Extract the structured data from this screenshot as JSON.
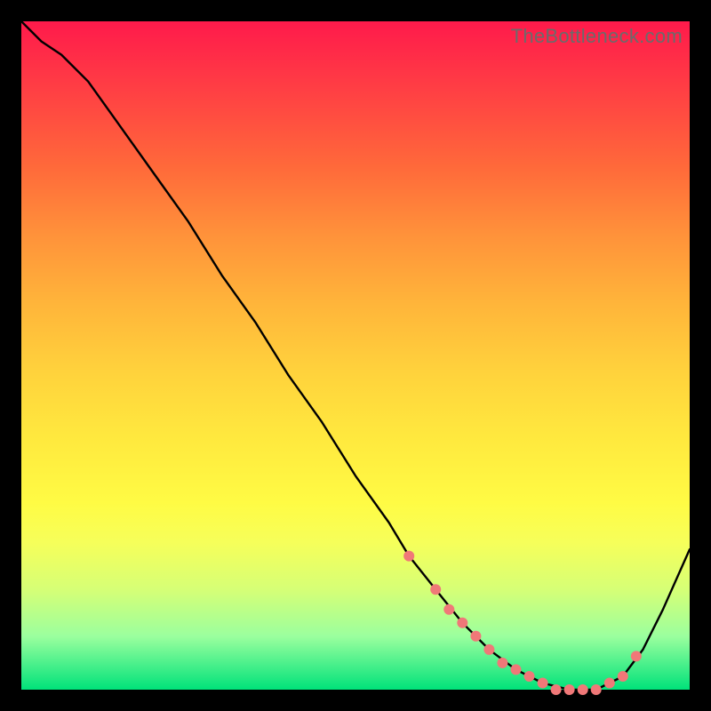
{
  "watermark": "TheBottleneck.com",
  "chart_data": {
    "type": "line",
    "title": "",
    "xlabel": "",
    "ylabel": "",
    "xlim": [
      0,
      100
    ],
    "ylim": [
      0,
      100
    ],
    "series": [
      {
        "name": "curve",
        "x": [
          0,
          3,
          6,
          10,
          15,
          20,
          25,
          30,
          35,
          40,
          45,
          50,
          55,
          58,
          62,
          66,
          70,
          74,
          78,
          82,
          86,
          90,
          93,
          96,
          100
        ],
        "y": [
          100,
          97,
          95,
          91,
          84,
          77,
          70,
          62,
          55,
          47,
          40,
          32,
          25,
          20,
          15,
          10,
          6,
          3,
          1,
          0,
          0,
          2,
          6,
          12,
          21
        ]
      }
    ],
    "markers": {
      "name": "highlight-dots",
      "color": "#f07878",
      "x": [
        58,
        62,
        64,
        66,
        68,
        70,
        72,
        74,
        76,
        78,
        80,
        82,
        84,
        86,
        88,
        90,
        92
      ],
      "y": [
        20,
        15,
        12,
        10,
        8,
        6,
        4,
        3,
        2,
        1,
        0,
        0,
        0,
        0,
        1,
        2,
        5
      ]
    }
  }
}
